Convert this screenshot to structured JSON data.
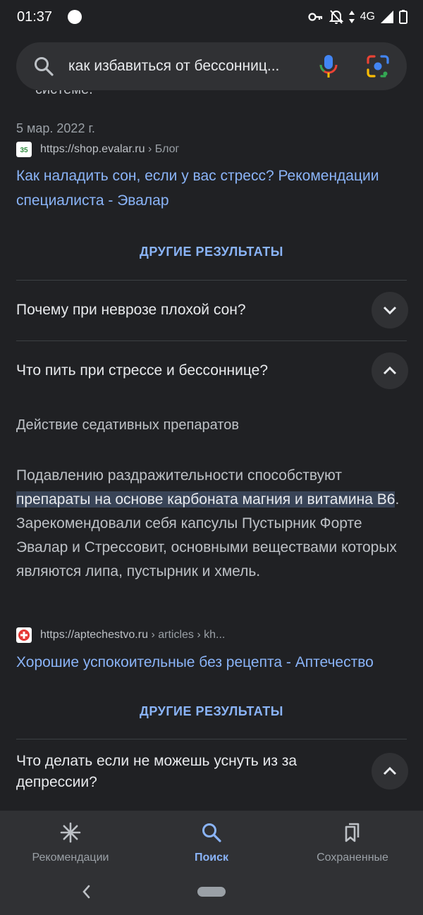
{
  "status_bar": {
    "time": "01:37",
    "network": "4G"
  },
  "search": {
    "query": "как избавиться от бессонниц..."
  },
  "partial_text": "системе.",
  "result1": {
    "date": "5 мар. 2022 г.",
    "url": "https://shop.evalar.ru",
    "crumb": "› Блог",
    "favicon_text": "35",
    "title": "Как наладить сон, если у вас стресс? Рекомендации специалиста - Эвалар"
  },
  "more_results_label": "ДРУГИЕ РЕЗУЛЬТАТЫ",
  "questions": [
    {
      "text": "Почему при неврозе плохой сон?",
      "expanded": false
    },
    {
      "text": "Что пить при стрессе и бессоннице?",
      "expanded": true
    },
    {
      "text": "Что делать если не можешь уснуть из за депрессии?",
      "expanded": true
    }
  ],
  "answer": {
    "heading": "Действие седативных препаратов",
    "before": "Подавлению раздражительности способствуют ",
    "highlight": "препараты на основе карбоната магния и витамина B6",
    "after": ". Зарекомендовали себя капсулы Пустырник Форте Эвалар и Стрессовит, основными веществами которых являются липа, пустырник и хмель."
  },
  "result2": {
    "url": "https://aptechestvo.ru",
    "crumb": "› articles › kh...",
    "title": "Хорошие успокоительные без рецепта - Аптечество"
  },
  "bottom_nav": [
    {
      "label": "Рекомендации",
      "icon": "asterisk-icon",
      "active": false
    },
    {
      "label": "Поиск",
      "icon": "search-icon",
      "active": true
    },
    {
      "label": "Сохраненные",
      "icon": "bookmarks-icon",
      "active": false
    }
  ],
  "colors": {
    "background": "#202124",
    "link": "#8ab4f8",
    "highlight": "#394457"
  }
}
